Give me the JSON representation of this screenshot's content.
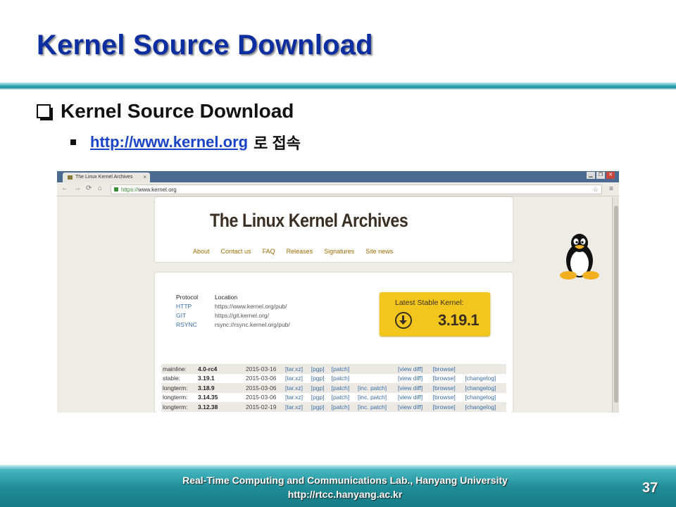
{
  "slide": {
    "title": "Kernel Source Download",
    "bullet_main": "Kernel Source Download",
    "bullet_sub_link": "http://www.kernel.org",
    "bullet_sub_suffix": "로 접속"
  },
  "browser": {
    "tab_title": "The Linux Kernel Archives",
    "tab_close": "×",
    "url_scheme": "https://",
    "url_host": "www.kernel.org",
    "site": {
      "banner_title": "The Linux Kernel Archives",
      "nav": [
        "About",
        "Contact us",
        "FAQ",
        "Releases",
        "Signatures",
        "Site news"
      ],
      "protocol_header": "Protocol",
      "location_header": "Location",
      "protocols": [
        {
          "name": "HTTP",
          "location": "https://www.kernel.org/pub/"
        },
        {
          "name": "GIT",
          "location": "https://git.kernel.org/"
        },
        {
          "name": "RSYNC",
          "location": "rsync://rsync.kernel.org/pub/"
        }
      ],
      "stable_label": "Latest Stable Kernel:",
      "stable_version": "3.19.1",
      "releases": [
        {
          "kind": "mainline:",
          "version": "4.0-rc4",
          "date": "2015-03-16",
          "tarxz": "[tar.xz]",
          "pgp": "[pgp]",
          "patch": "[patch]",
          "inc": "",
          "viewdiff": "[view diff]",
          "browse": "[browse]",
          "changelog": ""
        },
        {
          "kind": "stable:",
          "version": "3.19.1",
          "date": "2015-03-06",
          "tarxz": "[tar.xz]",
          "pgp": "[pgp]",
          "patch": "[patch]",
          "inc": "",
          "viewdiff": "[view diff]",
          "browse": "[browse]",
          "changelog": "[changelog]"
        },
        {
          "kind": "longterm:",
          "version": "3.18.9",
          "date": "2015-03-06",
          "tarxz": "[tar.xz]",
          "pgp": "[pgp]",
          "patch": "[patch]",
          "inc": "[inc. patch]",
          "viewdiff": "[view diff]",
          "browse": "[browse]",
          "changelog": "[changelog]"
        },
        {
          "kind": "longterm:",
          "version": "3.14.35",
          "date": "2015-03-06",
          "tarxz": "[tar.xz]",
          "pgp": "[pgp]",
          "patch": "[patch]",
          "inc": "[inc. patch]",
          "viewdiff": "[view diff]",
          "browse": "[browse]",
          "changelog": "[changelog]"
        },
        {
          "kind": "longterm:",
          "version": "3.12.38",
          "date": "2015-02-19",
          "tarxz": "[tar.xz]",
          "pgp": "[pgp]",
          "patch": "[patch]",
          "inc": "[inc. patch]",
          "viewdiff": "[view diff]",
          "browse": "[browse]",
          "changelog": "[changelog]"
        }
      ]
    }
  },
  "footer": {
    "line1": "Real-Time Computing and Communications Lab., Hanyang University",
    "line2": "http://rtcc.hanyang.ac.kr",
    "page_number": "37"
  },
  "colors": {
    "title": "#0c2ea0",
    "link": "#1a44c8",
    "accent_teal": "#1e8c97",
    "kernel_yellow": "#f2c61c"
  }
}
